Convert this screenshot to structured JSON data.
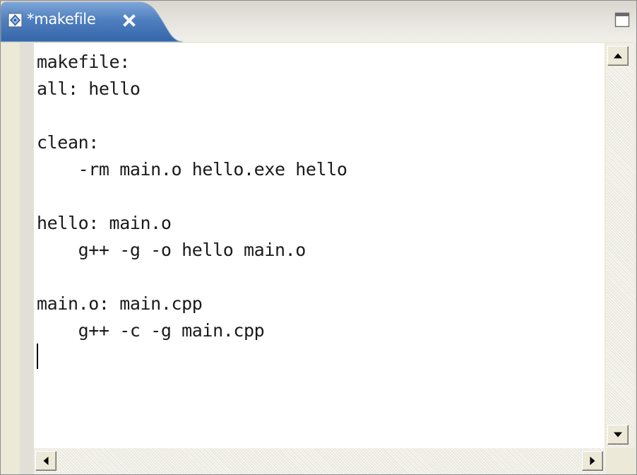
{
  "editor_tab": {
    "title": "*makefile",
    "file_icon": "makefile-file-icon",
    "close_icon": "close-icon"
  },
  "view_controls": {
    "maximize_icon": "maximize-icon"
  },
  "editor": {
    "lines": [
      "makefile:",
      "all: hello",
      "",
      "clean:",
      "    -rm main.o hello.exe hello",
      "",
      "hello: main.o",
      "    g++ -g -o hello main.o",
      "",
      "main.o: main.cpp",
      "    g++ -c -g main.cpp"
    ]
  },
  "scrollbars": {
    "up_icon": "arrow-up-icon",
    "down_icon": "arrow-down-icon",
    "left_icon": "arrow-left-icon",
    "right_icon": "arrow-right-icon"
  },
  "colors": {
    "active_tab_fill": "#4f7fbf",
    "tab_strip": "#e7e5df",
    "editor_background": "#ffffff",
    "text": "#1a1a1a"
  }
}
